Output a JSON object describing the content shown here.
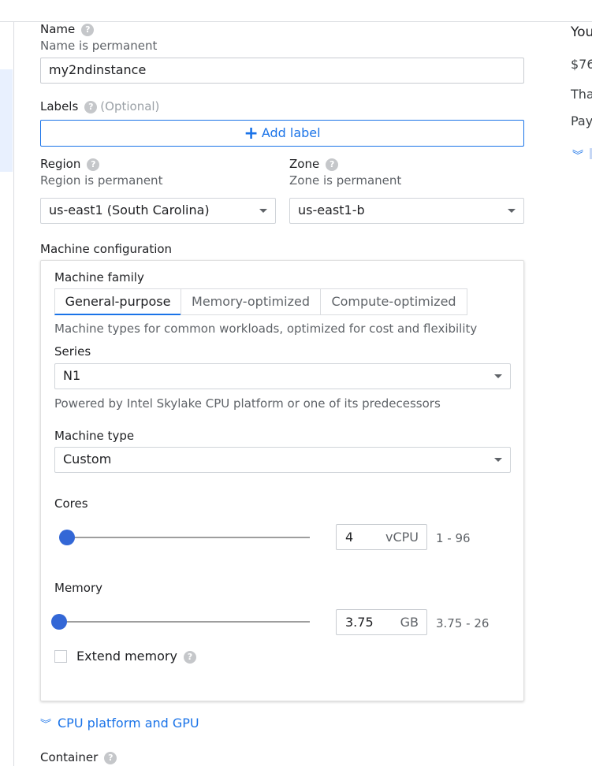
{
  "form": {
    "name": {
      "label": "Name",
      "hint": "Name is permanent",
      "value": "my2ndinstance"
    },
    "labels": {
      "label": "Labels",
      "optional": "(Optional)",
      "add_button": "Add label"
    },
    "region": {
      "label": "Region",
      "hint": "Region is permanent",
      "value": "us-east1 (South Carolina)"
    },
    "zone": {
      "label": "Zone",
      "hint": "Zone is permanent",
      "value": "us-east1-b"
    }
  },
  "machine": {
    "section_title": "Machine configuration",
    "family_label": "Machine family",
    "tabs": [
      {
        "label": "General-purpose",
        "active": true
      },
      {
        "label": "Memory-optimized",
        "active": false
      },
      {
        "label": "Compute-optimized",
        "active": false
      }
    ],
    "family_description": "Machine types for common workloads, optimized for cost and flexibility",
    "series_label": "Series",
    "series_value": "N1",
    "series_description": "Powered by Intel Skylake CPU platform or one of its predecessors",
    "type_label": "Machine type",
    "type_value": "Custom",
    "cores": {
      "label": "Cores",
      "value": "4",
      "unit": "vCPU",
      "range": "1 - 96",
      "slider_fraction": 0.03
    },
    "memory": {
      "label": "Memory",
      "value": "3.75",
      "unit": "GB",
      "range": "3.75 - 26",
      "slider_fraction": 0.0
    },
    "extend_memory": {
      "label": "Extend memory",
      "checked": false
    }
  },
  "cpu_platform_link": "CPU platform and GPU",
  "container_label": "Container",
  "right_panel": {
    "line1": "You",
    "line2": "$76",
    "line3": "Tha",
    "line4": "Pay"
  },
  "colors": {
    "accent": "#1a73e8",
    "slider_thumb": "#3367d6",
    "hint": "#5f6368"
  },
  "icons": [
    "help-icon",
    "plus-icon",
    "chevron-down-icon",
    "double-chevron-down-icon"
  ]
}
